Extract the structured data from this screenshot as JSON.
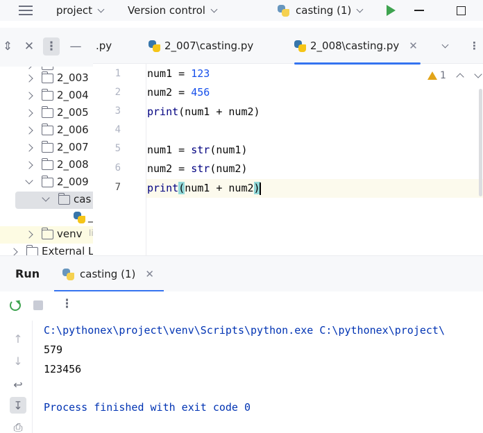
{
  "titlebar": {
    "project": "project",
    "vcs": "Version control",
    "run_config": "casting (1)"
  },
  "tree": {
    "items": [
      {
        "label": "2_003"
      },
      {
        "label": "2_004"
      },
      {
        "label": "2_005"
      },
      {
        "label": "2_006"
      },
      {
        "label": "2_007"
      },
      {
        "label": "2_008"
      },
      {
        "label": "2_009"
      }
    ],
    "selected": "cas",
    "file": "_",
    "venv": "venv",
    "venv_hint": "li",
    "external": "External L"
  },
  "tabs": [
    {
      "label": ".py"
    },
    {
      "label": "2_007\\casting.py"
    },
    {
      "label": "2_008\\casting.py",
      "active": true
    }
  ],
  "editor": {
    "line_numbers": [
      "1",
      "2",
      "3",
      "4",
      "5",
      "6",
      "7"
    ],
    "lines": [
      {
        "a": "num1 = ",
        "n": "123"
      },
      {
        "a": "num2 = ",
        "n": "456"
      },
      {
        "f": "print",
        "a": "(num1 + num2)"
      },
      {},
      {
        "a": "num1 = ",
        "f": "str",
        "b": "(num1)"
      },
      {
        "a": "num2 = ",
        "f": "str",
        "b": "(num2)"
      },
      {
        "f": "print",
        "o": "(",
        "a": "num1 + num2",
        "c": ")"
      }
    ],
    "warnings": "1"
  },
  "run": {
    "title": "Run",
    "tab": "casting (1)",
    "output": [
      "C:\\pythonex\\project\\venv\\Scripts\\python.exe C:\\pythonex\\project\\",
      "579",
      "123456",
      "",
      "Process finished with exit code 0"
    ]
  }
}
